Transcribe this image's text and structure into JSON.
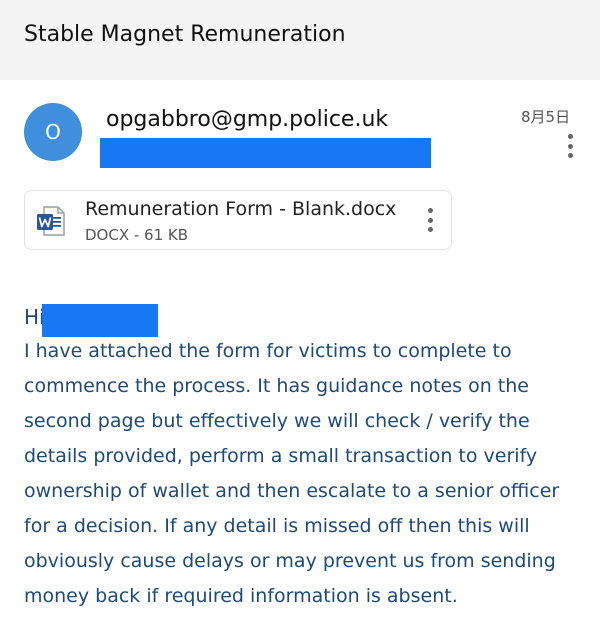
{
  "subject": "Stable Magnet Remuneration",
  "sender": {
    "avatar_initial": "O",
    "email": "opgabbro@gmp.police.uk",
    "date": "8月5日"
  },
  "attachment": {
    "file_name": "Remuneration Form - Blank.docx",
    "file_meta": "DOCX - 61 KB",
    "icon": "word-doc-icon"
  },
  "body": {
    "greeting": "Hi",
    "lines": [
      "I have attached the form for victims to complete to",
      "commence the process. It has guidance notes on the",
      "second page but effectively we will check / verify the",
      "details provided, perform a small transaction to verify",
      "ownership of wallet and then escalate to a senior officer",
      "for a decision. If any detail is missed off then this will",
      "obviously cause delays or may prevent us from sending",
      "money back if required information is absent."
    ]
  },
  "colors": {
    "avatar": "#3f8fdc",
    "redaction": "#1877f2",
    "body_text": "#1e4a7a",
    "subject_bar": "#f4f4f4"
  }
}
